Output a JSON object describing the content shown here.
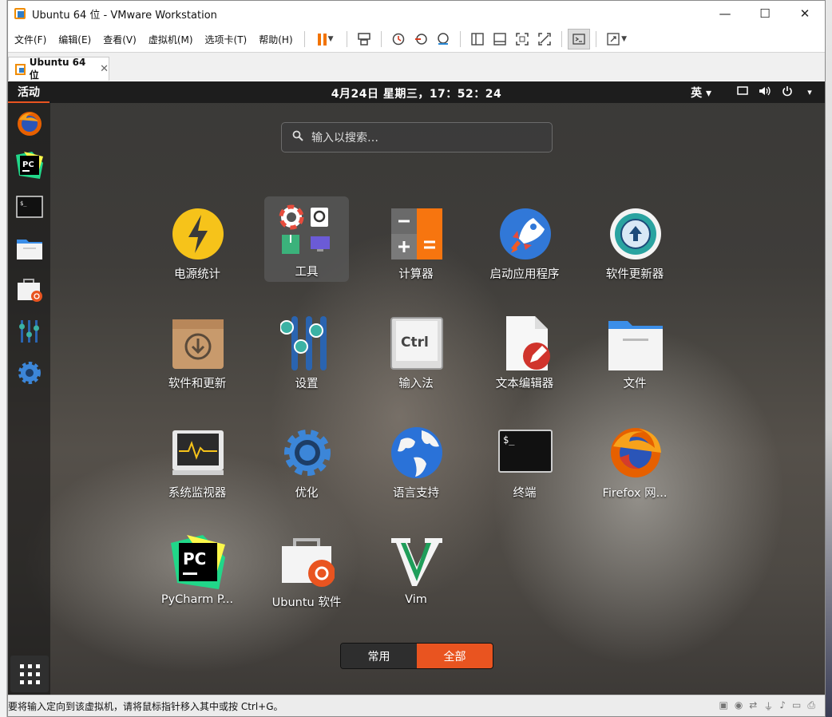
{
  "window": {
    "title": "Ubuntu 64 位 - VMware Workstation",
    "minimize": "—",
    "maximize": "☐",
    "close": "✕"
  },
  "menu": {
    "items": [
      "文件(F)",
      "编辑(E)",
      "查看(V)",
      "虚拟机(M)",
      "选项卡(T)",
      "帮助(H)"
    ]
  },
  "toolbar": {
    "icons": [
      "pause-icon",
      "send-ctrl-alt-del-icon",
      "snapshot-take-icon",
      "snapshot-revert-icon",
      "snapshot-manager-icon",
      "library-view-icon",
      "thumbnail-view-icon",
      "fullscreen-icon",
      "unity-icon",
      "console-view-icon",
      "stretch-guest-icon"
    ]
  },
  "tab": {
    "label": "Ubuntu 64 位",
    "close": "✕"
  },
  "guest": {
    "topbar": {
      "activities": "活动",
      "clock": "4月24日 星期三，17：52：24",
      "input_method": "英 ▾",
      "power_menu": "▾"
    },
    "search": {
      "placeholder": "输入以搜索…"
    },
    "apps": [
      "电源统计",
      "工具",
      "计算器",
      "启动应用程序",
      "软件更新器",
      "软件和更新",
      "设置",
      "输入法",
      "文本编辑器",
      "文件",
      "系统监视器",
      "优化",
      "语言支持",
      "终端",
      "Firefox 网...",
      "PyCharm P...",
      "Ubuntu 软件",
      "Vim"
    ],
    "terminal_prompt": "$_",
    "ctrl_key": "Ctrl",
    "pycharm_logo": "PC",
    "view_switch": {
      "frequent": "常用",
      "all": "全部"
    }
  },
  "colors": {
    "ubuntu_orange": "#e95420",
    "topbar": "#1d1d1d",
    "vmware_pause": "#f27300"
  },
  "statusbar": {
    "message": "要将输入定向到该虚拟机，请将鼠标指针移入其中或按 Ctrl+G。"
  }
}
